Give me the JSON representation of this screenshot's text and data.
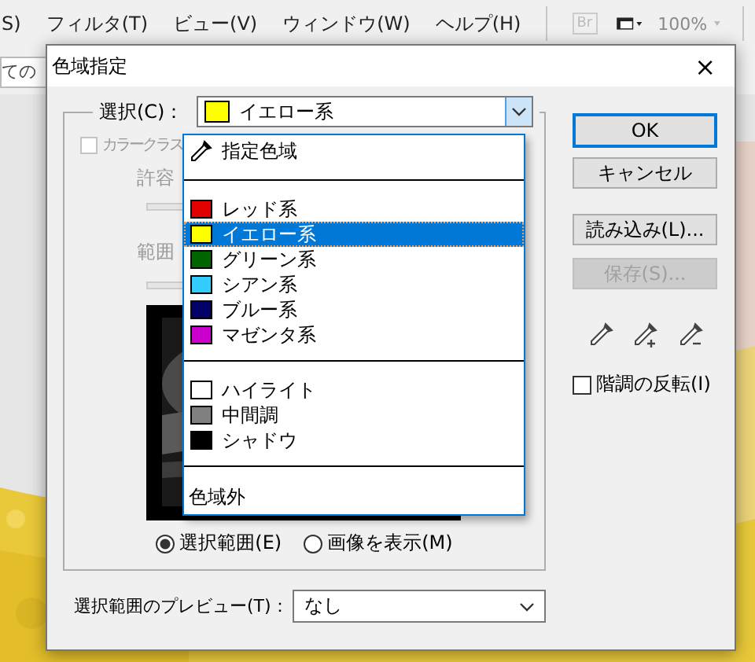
{
  "menu_bar": {
    "items": [
      "S)",
      "フィルタ(T)",
      "ビュー(V)",
      "ウィンドウ(W)",
      "ヘルプ(H)"
    ],
    "bridge_icon": "Br",
    "zoom": "100%"
  },
  "options_field": {
    "value": "ての"
  },
  "dialog": {
    "title": "色域指定",
    "close": "×",
    "select": {
      "label": "選択(C)：",
      "value": "イエロー系",
      "color": "#ffff00"
    },
    "dropdown": [
      {
        "kind": "picker",
        "label": "指定色域",
        "selected": false
      },
      {
        "kind": "separator"
      },
      {
        "kind": "swatch",
        "label": "レッド系",
        "color": "#e00000",
        "selected": false
      },
      {
        "kind": "swatch",
        "label": "イエロー系",
        "color": "#ffff00",
        "selected": true
      },
      {
        "kind": "swatch",
        "label": "グリーン系",
        "color": "#006400",
        "selected": false
      },
      {
        "kind": "swatch",
        "label": "シアン系",
        "color": "#33ccff",
        "selected": false
      },
      {
        "kind": "swatch",
        "label": "ブルー系",
        "color": "#000066",
        "selected": false
      },
      {
        "kind": "swatch",
        "label": "マゼンタ系",
        "color": "#cc00cc",
        "selected": false
      },
      {
        "kind": "separator"
      },
      {
        "kind": "swatch",
        "label": "ハイライト",
        "color": "#ffffff",
        "selected": false
      },
      {
        "kind": "swatch",
        "label": "中間調",
        "color": "#808080",
        "selected": false
      },
      {
        "kind": "swatch",
        "label": "シャドウ",
        "color": "#000000",
        "selected": false
      },
      {
        "kind": "separator"
      },
      {
        "kind": "plain",
        "label": "色域外",
        "selected": false
      }
    ],
    "color_clusters": {
      "label": "カラークラス",
      "checked": false,
      "disabled": true
    },
    "fuzziness_label": "許容",
    "range_label": "範囲",
    "view_options": [
      {
        "label": "選択範囲(E)",
        "selected": true
      },
      {
        "label": "画像を表示(M)",
        "selected": false
      }
    ],
    "preview": {
      "label": "選択範囲のプレビュー(T)：",
      "value": "なし"
    },
    "buttons": [
      {
        "label": "OK",
        "default": true,
        "disabled": false
      },
      {
        "label": "キャンセル",
        "default": false,
        "disabled": false
      },
      {
        "label": "読み込み(L)...",
        "default": false,
        "disabled": false
      },
      {
        "label": "保存(S)...",
        "default": false,
        "disabled": true
      }
    ],
    "invert": {
      "label": "階調の反転(I)",
      "checked": false
    }
  }
}
